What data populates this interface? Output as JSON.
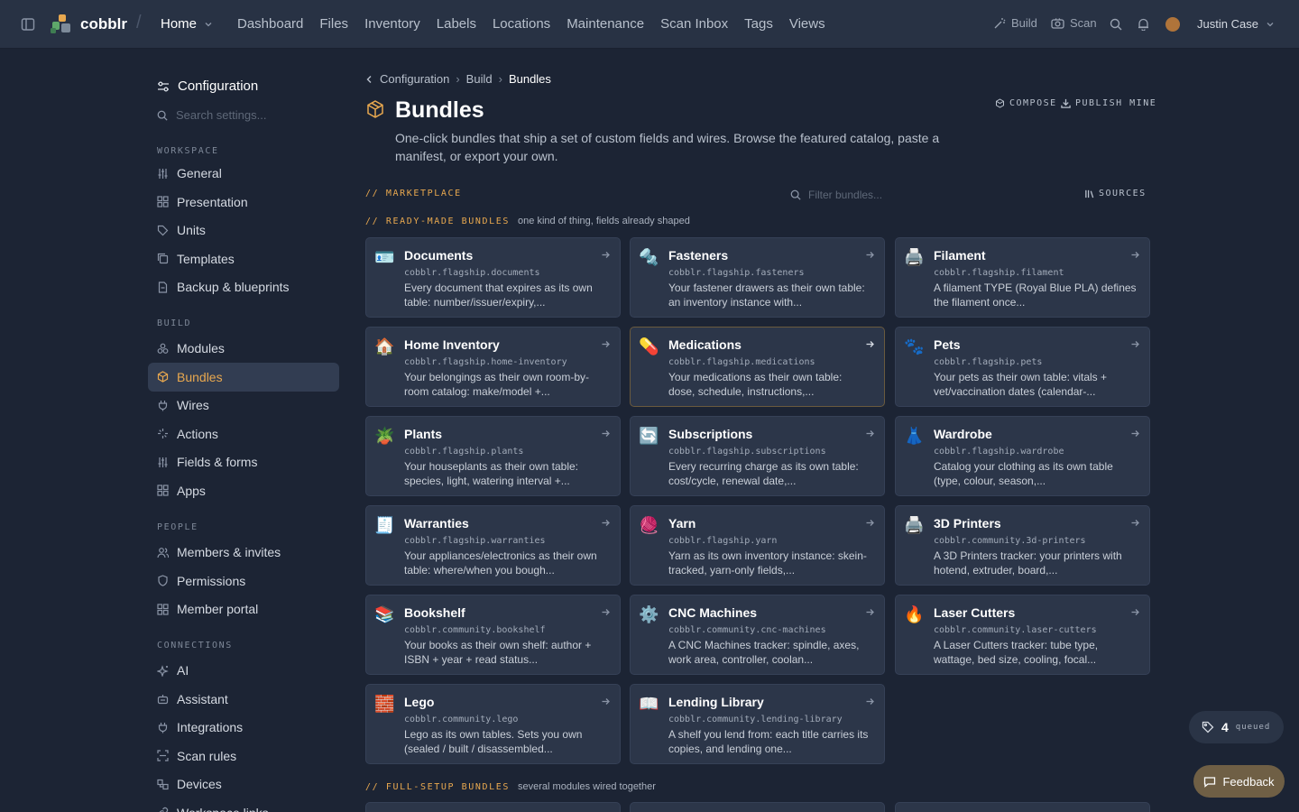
{
  "app": {
    "name": "cobblr",
    "workspace": "Home"
  },
  "nav": [
    "Dashboard",
    "Files",
    "Inventory",
    "Labels",
    "Locations",
    "Maintenance",
    "Scan Inbox",
    "Tags",
    "Views"
  ],
  "topbar": {
    "build_label": "Build",
    "scan_label": "Scan",
    "user_name": "Justin Case"
  },
  "sidebar": {
    "title": "Configuration",
    "search_placeholder": "Search settings...",
    "sections": {
      "workspace": "WORKSPACE",
      "build": "BUILD",
      "people": "PEOPLE",
      "connections": "CONNECTIONS"
    },
    "workspace_items": [
      "General",
      "Presentation",
      "Units",
      "Templates",
      "Backup & blueprints"
    ],
    "build_items": [
      "Modules",
      "Bundles",
      "Wires",
      "Actions",
      "Fields & forms",
      "Apps"
    ],
    "people_items": [
      "Members & invites",
      "Permissions",
      "Member portal"
    ],
    "connection_items": [
      "AI",
      "Assistant",
      "Integrations",
      "Scan rules",
      "Devices",
      "Workspace links"
    ]
  },
  "breadcrumb": [
    "Configuration",
    "Build",
    "Bundles"
  ],
  "page": {
    "title": "Bundles",
    "description": "One-click bundles that ship a set of custom fields and wires. Browse the featured catalog, paste a manifest, or export your own.",
    "compose_label": "COMPOSE",
    "publish_label": "PUBLISH MINE"
  },
  "marketplace": {
    "label": "// MARKETPLACE",
    "filter_placeholder": "Filter bundles...",
    "sources_label": "SOURCES",
    "ready_label": "// READY-MADE BUNDLES",
    "ready_sub": "one kind of thing, fields already shaped",
    "full_label": "// FULL-SETUP BUNDLES",
    "full_sub": "several modules wired together"
  },
  "bundles": [
    {
      "emoji": "🪪",
      "name": "Documents",
      "slug": "cobblr.flagship.documents",
      "desc": "Every document that expires as its own table: number/issuer/expiry,..."
    },
    {
      "emoji": "🔩",
      "name": "Fasteners",
      "slug": "cobblr.flagship.fasteners",
      "desc": "Your fastener drawers as their own table: an inventory instance with..."
    },
    {
      "emoji": "🖨️",
      "name": "Filament",
      "slug": "cobblr.flagship.filament",
      "desc": "A filament TYPE (Royal Blue PLA) defines the filament once..."
    },
    {
      "emoji": "🏠",
      "name": "Home Inventory",
      "slug": "cobblr.flagship.home-inventory",
      "desc": "Your belongings as their own room-by-room catalog: make/model +..."
    },
    {
      "emoji": "💊",
      "name": "Medications",
      "slug": "cobblr.flagship.medications",
      "desc": "Your medications as their own table: dose, schedule, instructions,..."
    },
    {
      "emoji": "🐾",
      "name": "Pets",
      "slug": "cobblr.flagship.pets",
      "desc": "Your pets as their own table: vitals + vet/vaccination dates (calendar-..."
    },
    {
      "emoji": "🪴",
      "name": "Plants",
      "slug": "cobblr.flagship.plants",
      "desc": "Your houseplants as their own table: species, light, watering interval +..."
    },
    {
      "emoji": "🔄",
      "name": "Subscriptions",
      "slug": "cobblr.flagship.subscriptions",
      "desc": "Every recurring charge as its own table: cost/cycle, renewal date,..."
    },
    {
      "emoji": "👗",
      "name": "Wardrobe",
      "slug": "cobblr.flagship.wardrobe",
      "desc": "Catalog your clothing as its own table (type, colour, season,..."
    },
    {
      "emoji": "🧾",
      "name": "Warranties",
      "slug": "cobblr.flagship.warranties",
      "desc": "Your appliances/electronics as their own table: where/when you bough..."
    },
    {
      "emoji": "🧶",
      "name": "Yarn",
      "slug": "cobblr.flagship.yarn",
      "desc": "Yarn as its own inventory instance: skein-tracked, yarn-only fields,..."
    },
    {
      "emoji": "🖨️",
      "name": "3D Printers",
      "slug": "cobblr.community.3d-printers",
      "desc": "A 3D Printers tracker: your printers with hotend, extruder, board,..."
    },
    {
      "emoji": "📚",
      "name": "Bookshelf",
      "slug": "cobblr.community.bookshelf",
      "desc": "Your books as their own shelf: author + ISBN + year + read status..."
    },
    {
      "emoji": "⚙️",
      "name": "CNC Machines",
      "slug": "cobblr.community.cnc-machines",
      "desc": "A CNC Machines tracker: spindle, axes, work area, controller, coolan..."
    },
    {
      "emoji": "🔥",
      "name": "Laser Cutters",
      "slug": "cobblr.community.laser-cutters",
      "desc": "A Laser Cutters tracker: tube type, wattage, bed size, cooling, focal..."
    },
    {
      "emoji": "🧱",
      "name": "Lego",
      "slug": "cobblr.community.lego",
      "desc": "Lego as its own tables. Sets you own (sealed / built / disassembled..."
    },
    {
      "emoji": "📖",
      "name": "Lending Library",
      "slug": "cobblr.community.lending-library",
      "desc": "A shelf you lend from: each title carries its copies, and lending one..."
    }
  ],
  "queue": {
    "count": "4",
    "label": "queued"
  },
  "feedback_label": "Feedback",
  "colors": {
    "accent": "#e8a84f",
    "background": "#1c2434",
    "card": "#2c3649",
    "topbar": "#283244"
  }
}
